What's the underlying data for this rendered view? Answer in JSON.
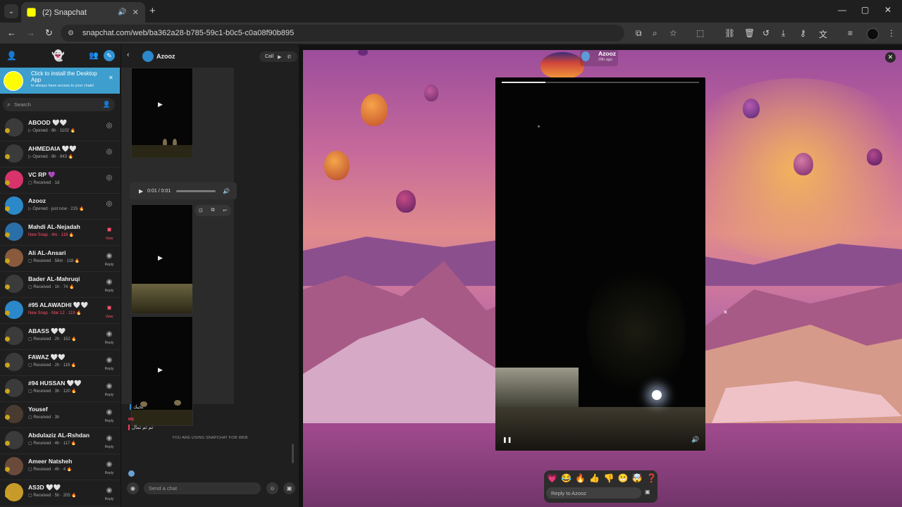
{
  "browser": {
    "tab_title": "(2) Snapchat",
    "url": "snapchat.com/web/ba362a28-b785-59c1-b0c5-c0a08f90b895",
    "window_controls": [
      "—",
      "▢",
      "✕"
    ]
  },
  "sidebar": {
    "install_banner": {
      "title": "Click to install the Desktop App",
      "subtitle": "to always have access to your chats!"
    },
    "search_placeholder": "Search",
    "chats": [
      {
        "name": "ABOOD 🤍🤍",
        "status": "▷ Opened · 8h · 1102 🔥",
        "action": "◎",
        "action_label": "",
        "status_color": "grey",
        "avatar_color": "#3b3b3b"
      },
      {
        "name": "AHMEDAIA 🤍🤍",
        "status": "▷ Opened · 8h · 843 🔥",
        "action": "◎",
        "action_label": "",
        "status_color": "grey",
        "avatar_color": "#3b3b3b"
      },
      {
        "name": "VC RP 💜",
        "status": "▢ Received · 1d",
        "action": "◎",
        "action_label": "",
        "status_color": "grey",
        "avatar_color": "#d8336b"
      },
      {
        "name": "Azooz",
        "status": "▷ Opened · just now · 215 🔥",
        "action": "◎",
        "action_label": "",
        "status_color": "grey",
        "avatar_color": "#2b88c9"
      },
      {
        "name": "Mahdi AL-Nejadah",
        "status": "New Snap · 4m · 118 🔥",
        "action": "■",
        "action_label": "View",
        "status_color": "red",
        "avatar_color": "#2b6fa8"
      },
      {
        "name": "Ali AL-Ansari",
        "status": "▢ Received · 56m · 118 🔥",
        "action": "◉",
        "action_label": "Reply",
        "status_color": "grey",
        "avatar_color": "#8a5a3c"
      },
      {
        "name": "Bader AL-Mahruqi",
        "status": "▢ Received · 1h · 74 🔥",
        "action": "◉",
        "action_label": "Reply",
        "status_color": "grey",
        "avatar_color": "#3b3b3b"
      },
      {
        "name": "#95 ALAWADHI 🤍🤍",
        "status": "New Snap · Mar 12 · 119 🔥",
        "action": "■",
        "action_label": "View",
        "status_color": "red",
        "avatar_color": "#2b88c9"
      },
      {
        "name": "ABASS 🤍🤍",
        "status": "▢ Received · 2h · 152 🔥",
        "action": "◉",
        "action_label": "Reply",
        "status_color": "grey",
        "avatar_color": "#3b3b3b"
      },
      {
        "name": "FAWAZ 🤍🤍",
        "status": "▢ Received · 2h · 119 🔥",
        "action": "◉",
        "action_label": "Reply",
        "status_color": "grey",
        "avatar_color": "#3b3b3b"
      },
      {
        "name": "#94 HUSSAN 🤍🤍",
        "status": "▢ Received · 3h · 120 🔥",
        "action": "◉",
        "action_label": "Reply",
        "status_color": "grey",
        "avatar_color": "#3b3b3b"
      },
      {
        "name": "Yousef",
        "status": "▢ Received · 3h",
        "action": "◉",
        "action_label": "Reply",
        "status_color": "grey",
        "avatar_color": "#4a3b30"
      },
      {
        "name": "Abdulaziz AL-Rshdan",
        "status": "▢ Received · 4h · 117 🔥",
        "action": "◉",
        "action_label": "Reply",
        "status_color": "grey",
        "avatar_color": "#3b3b3b"
      },
      {
        "name": "Ameer Natsheh",
        "status": "▢ Received · 4h · 4 🔥",
        "action": "◉",
        "action_label": "Reply",
        "status_color": "grey",
        "avatar_color": "#6a4a3a"
      },
      {
        "name": "AS3D 🤍🤍",
        "status": "▢ Received · 5h · 205 🔥",
        "action": "◉",
        "action_label": "Reply",
        "status_color": "grey",
        "avatar_color": "#c89a2a"
      }
    ]
  },
  "chat": {
    "contact_name": "Azooz",
    "call_label": "Call",
    "audio_time": "0:01 / 0:01",
    "reply_text": "بجيك",
    "me_label": "ME",
    "me_text": "تم تم تمال",
    "using_web_notice": "YOU ARE USING SNAPCHAT FOR WEB",
    "input_placeholder": "Send a chat"
  },
  "story": {
    "user_name": "Azooz",
    "time": "29h ago",
    "progress": 0.22,
    "reactions": [
      "💗",
      "😂",
      "🔥",
      "👍",
      "👎",
      "😬",
      "🤯",
      "❓"
    ],
    "reply_placeholder": "Reply to Azooz"
  },
  "colors": {
    "snap_yellow": "#fffc00",
    "banner_blue": "#3e9ecd",
    "new_snap_red": "#ff4f6b"
  }
}
